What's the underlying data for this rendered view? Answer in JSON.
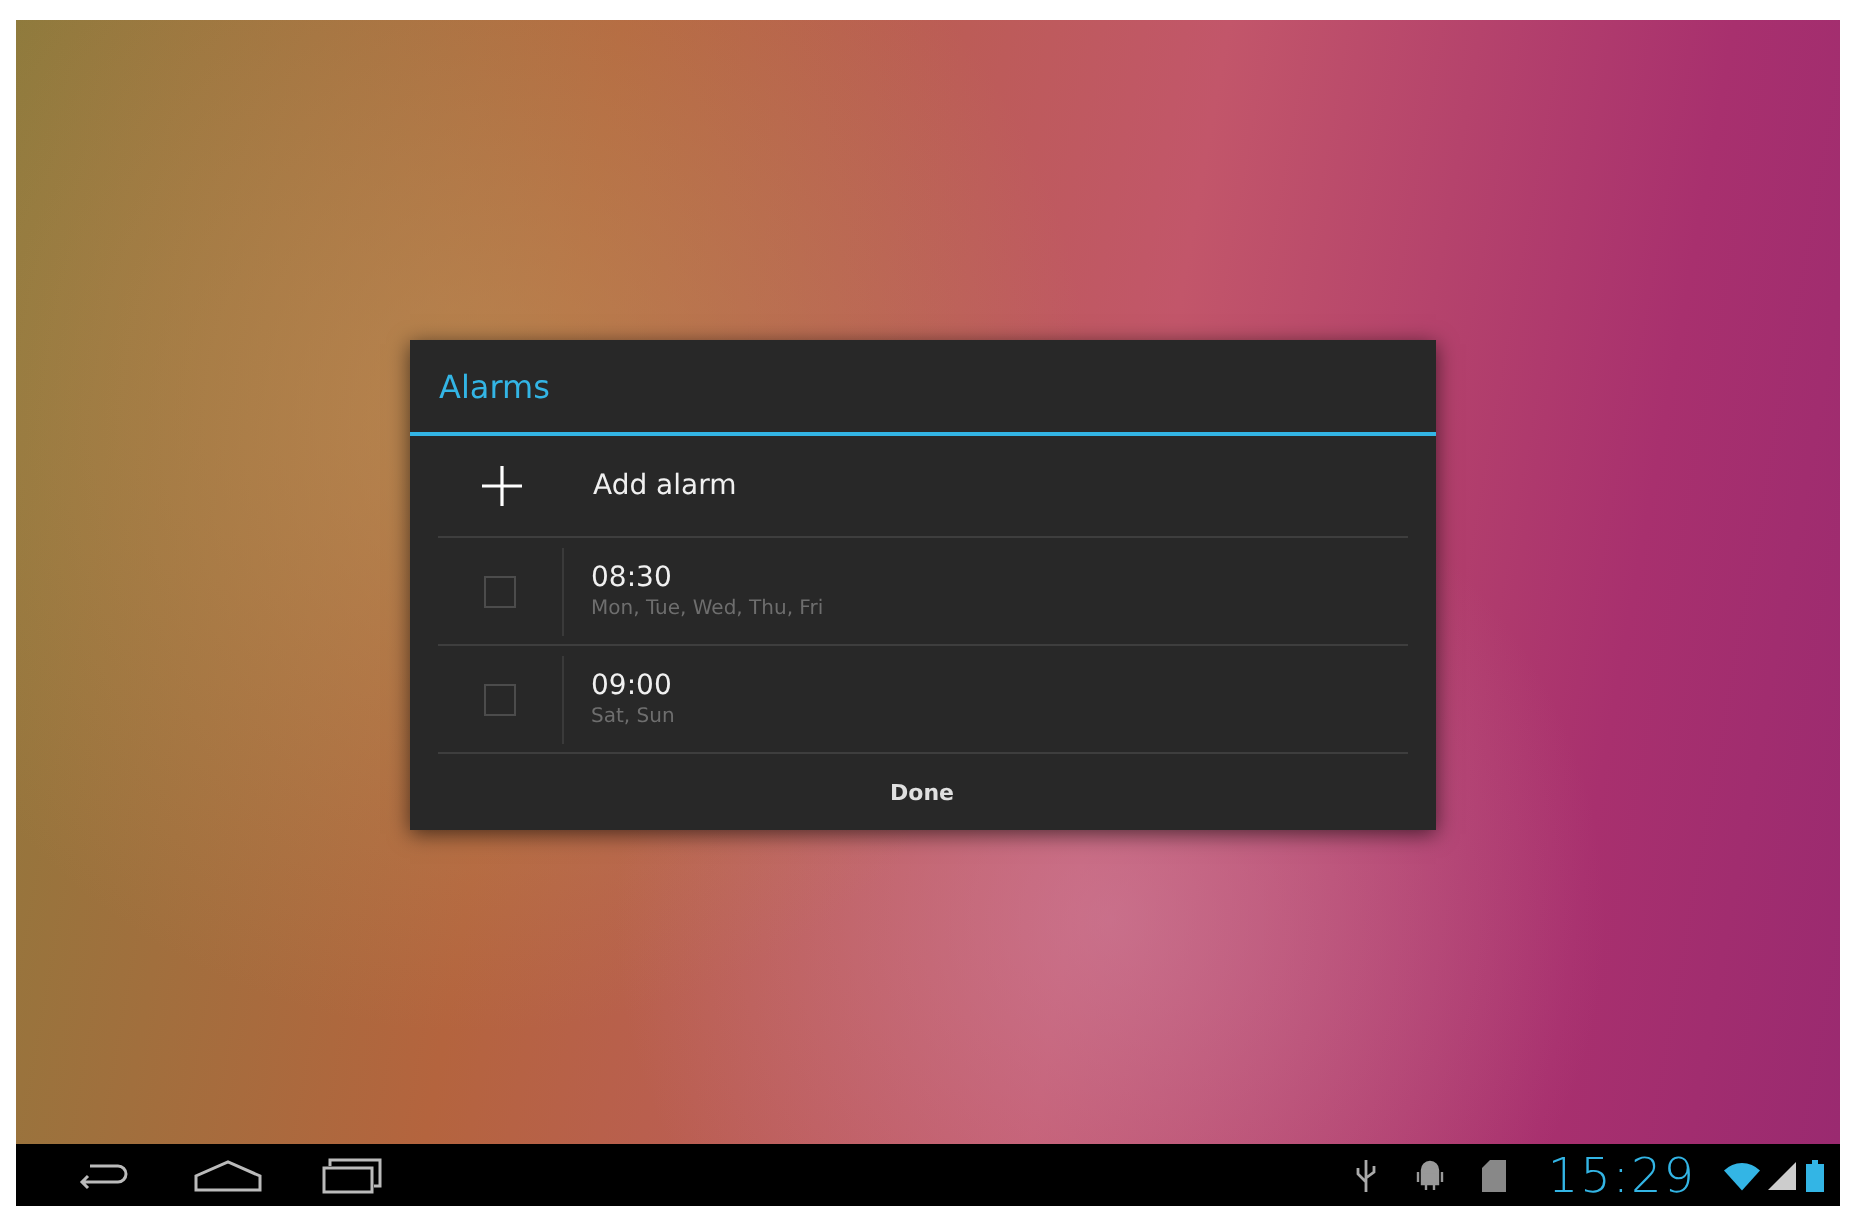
{
  "dialog": {
    "title": "Alarms",
    "add_label": "Add alarm",
    "alarms": [
      {
        "time": "08:30",
        "days": "Mon, Tue, Wed, Thu, Fri",
        "checked": false
      },
      {
        "time": "09:00",
        "days": "Sat, Sun",
        "checked": false
      }
    ],
    "done": "Done"
  },
  "status_bar": {
    "time": "15:29"
  }
}
